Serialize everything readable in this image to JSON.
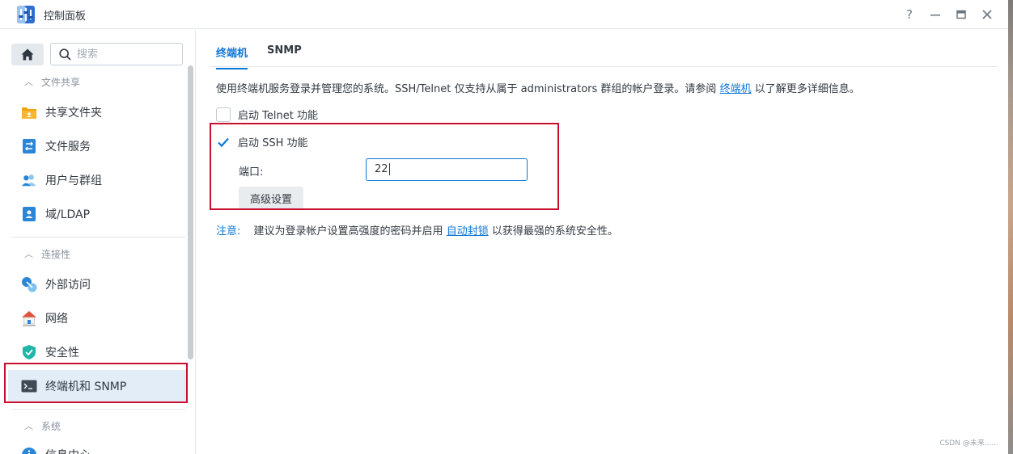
{
  "window": {
    "title": "控制面板",
    "controls": {
      "help": "?",
      "minimize": "—",
      "maximize": "☐",
      "close": "✕"
    }
  },
  "sidebar": {
    "search_placeholder": "搜索",
    "groups": [
      {
        "title": "文件共享",
        "items": [
          {
            "label": "共享文件夹",
            "icon": "folder-icon"
          },
          {
            "label": "文件服务",
            "icon": "file-services-icon"
          },
          {
            "label": "用户与群组",
            "icon": "users-icon"
          },
          {
            "label": "域/LDAP",
            "icon": "domain-icon"
          }
        ]
      },
      {
        "title": "连接性",
        "items": [
          {
            "label": "外部访问",
            "icon": "external-access-icon"
          },
          {
            "label": "网络",
            "icon": "network-icon"
          },
          {
            "label": "安全性",
            "icon": "shield-icon"
          },
          {
            "label": "终端机和 SNMP",
            "icon": "terminal-icon",
            "active": true
          }
        ]
      },
      {
        "title": "系统",
        "items": [
          {
            "label": "信息中心",
            "icon": "info-icon"
          }
        ]
      }
    ]
  },
  "main": {
    "tabs": [
      {
        "label": "终端机",
        "active": true
      },
      {
        "label": "SNMP",
        "active": false
      }
    ],
    "intro_text": "使用终端机服务登录并管理您的系统。SSH/Telnet 仅支持从属于 administrators 群组的帐户登录。请参阅",
    "intro_link": "终端机",
    "intro_suffix": "以了解更多详细信息。",
    "telnet_label": "启动 Telnet 功能",
    "telnet_checked": false,
    "ssh_label": "启动 SSH 功能",
    "ssh_checked": true,
    "port_label": "端口:",
    "port_value": "22",
    "advanced_button": "高级设置",
    "note_label": "注意:",
    "note_text": "建议为登录帐户设置高强度的密码并启用",
    "note_link": "自动封锁",
    "note_suffix": "以获得最强的系统安全性。"
  },
  "watermark": "CSDN @未来......",
  "colors": {
    "accent": "#0b77d8",
    "highlight": "#c8102e",
    "active_bg": "#e3edf8"
  }
}
